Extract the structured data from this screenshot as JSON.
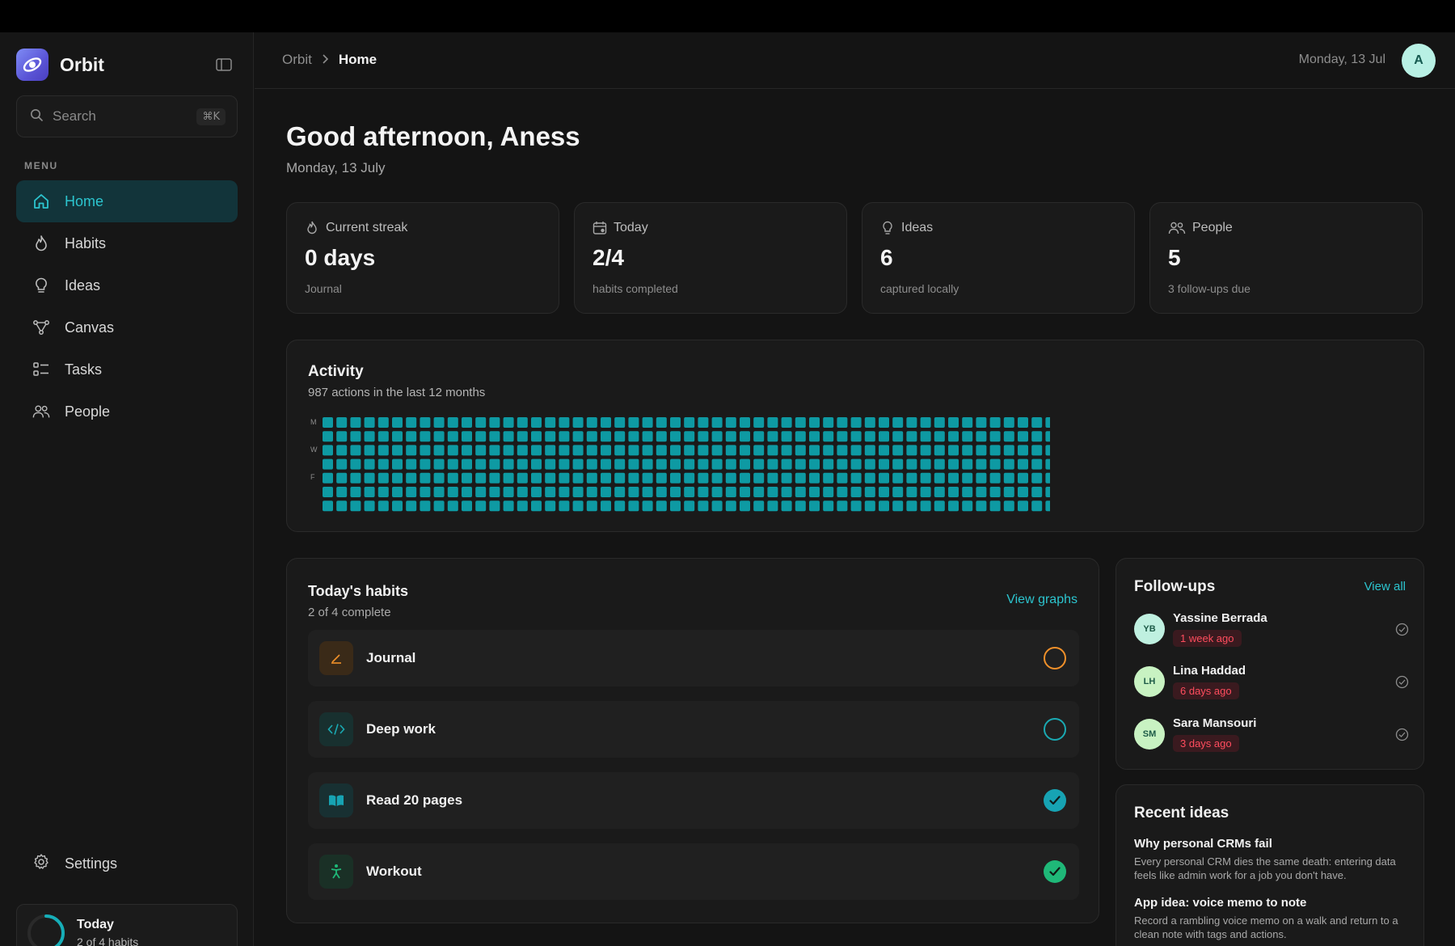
{
  "app": {
    "name": "Orbit"
  },
  "search": {
    "placeholder": "Search",
    "shortcut": "⌘K"
  },
  "sidebar": {
    "menu_label": "MENU",
    "items": [
      {
        "label": "Home",
        "icon": "home-icon",
        "active": true
      },
      {
        "label": "Habits",
        "icon": "flame-icon"
      },
      {
        "label": "Ideas",
        "icon": "lightbulb-icon"
      },
      {
        "label": "Canvas",
        "icon": "nodes-icon"
      },
      {
        "label": "Tasks",
        "icon": "list-icon"
      },
      {
        "label": "People",
        "icon": "users-icon"
      }
    ],
    "settings_label": "Settings",
    "today": {
      "title": "Today",
      "subtitle": "2 of 4 habits",
      "progress": 0.5
    }
  },
  "header": {
    "breadcrumb": [
      "Orbit",
      "Home"
    ],
    "date": "Monday, 13 Jul",
    "avatar_initial": "A"
  },
  "greeting": {
    "title": "Good afternoon, Aness",
    "date": "Monday, 13 July"
  },
  "stats": [
    {
      "label": "Current streak",
      "value": "0 days",
      "sub": "Journal",
      "icon": "flame-icon"
    },
    {
      "label": "Today",
      "value": "2/4",
      "sub": "habits completed",
      "icon": "calendar-icon"
    },
    {
      "label": "Ideas",
      "value": "6",
      "sub": "captured locally",
      "icon": "lightbulb-icon"
    },
    {
      "label": "People",
      "value": "5",
      "sub": "3 follow-ups due",
      "icon": "users-icon"
    }
  ],
  "activity": {
    "title": "Activity",
    "subtitle": "987 actions in the last 12 months",
    "day_labels": [
      "M",
      "W",
      "F"
    ],
    "weeks": 53,
    "days": 7,
    "cell_color": "#0e9aa3"
  },
  "habits": {
    "title": "Today's habits",
    "subtitle": "2 of 4 complete",
    "view_label": "View graphs",
    "items": [
      {
        "name": "Journal",
        "icon": "pencil-icon",
        "done": false,
        "color": "#f0902a",
        "bg": "#3a2a18"
      },
      {
        "name": "Deep work",
        "icon": "code-icon",
        "done": false,
        "color": "#1aa9b2",
        "bg": "#18302f"
      },
      {
        "name": "Read 20 pages",
        "icon": "book-icon",
        "done": true,
        "color": "#17a3b3",
        "bg": "#183032"
      },
      {
        "name": "Workout",
        "icon": "figure-icon",
        "done": true,
        "color": "#1fb878",
        "bg": "#1a3026"
      }
    ]
  },
  "followups": {
    "title": "Follow-ups",
    "view_label": "View all",
    "items": [
      {
        "initials": "YB",
        "name": "Yassine Berrada",
        "when": "1 week ago",
        "color": "#bff0e0"
      },
      {
        "initials": "LH",
        "name": "Lina Haddad",
        "when": "6 days ago",
        "color": "#c8f2c2"
      },
      {
        "initials": "SM",
        "name": "Sara Mansouri",
        "when": "3 days ago",
        "color": "#c8f2c2"
      }
    ]
  },
  "ideas": {
    "title": "Recent ideas",
    "items": [
      {
        "title": "Why personal CRMs fail",
        "desc": "Every personal CRM dies the same death: entering data feels like admin work for a job you don't have."
      },
      {
        "title": "App idea: voice memo to note",
        "desc": "Record a rambling voice memo on a walk and return to a clean note with tags and actions."
      }
    ]
  }
}
